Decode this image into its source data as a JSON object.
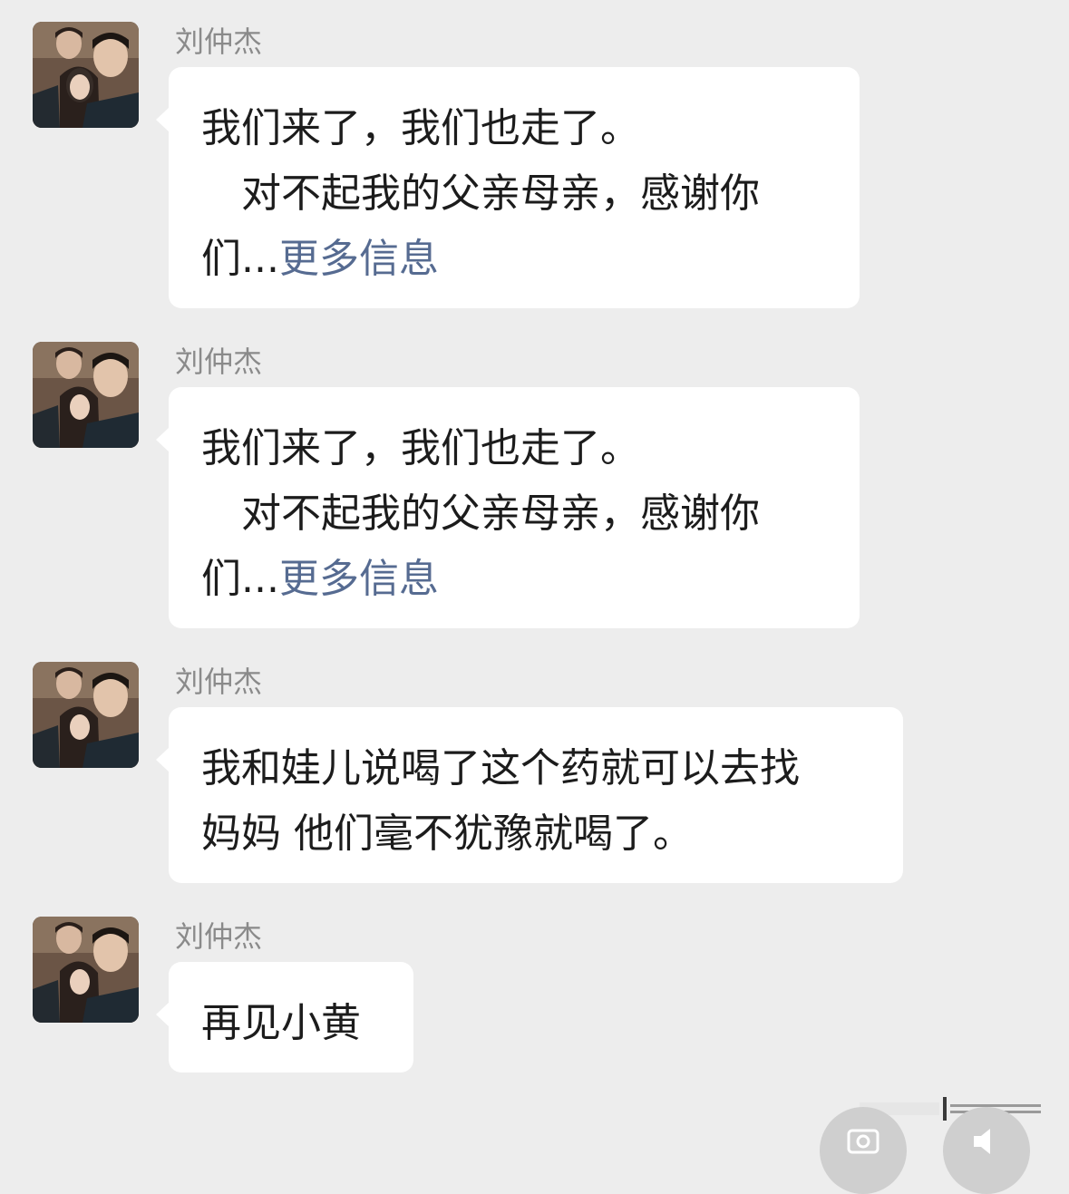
{
  "messages": [
    {
      "sender": "刘仲杰",
      "lines": [
        "我们来了，我们也走了。",
        "对不起我的父亲母亲，感谢你",
        "们..."
      ],
      "more_link": "更多信息"
    },
    {
      "sender": "刘仲杰",
      "lines": [
        "我们来了，我们也走了。",
        "对不起我的父亲母亲，感谢你",
        "们..."
      ],
      "more_link": "更多信息"
    },
    {
      "sender": "刘仲杰",
      "lines": [
        "我和娃儿说喝了这个药就可以去找",
        "妈妈 他们毫不犹豫就喝了。"
      ]
    },
    {
      "sender": "刘仲杰",
      "lines": [
        "再见小黄"
      ]
    }
  ],
  "icons": {
    "avatar": "avatar-photo",
    "left_float": "camera-icon",
    "right_float": "speaker-icon"
  },
  "colors": {
    "background": "#ededed",
    "bubble": "#ffffff",
    "link": "#566b91"
  }
}
